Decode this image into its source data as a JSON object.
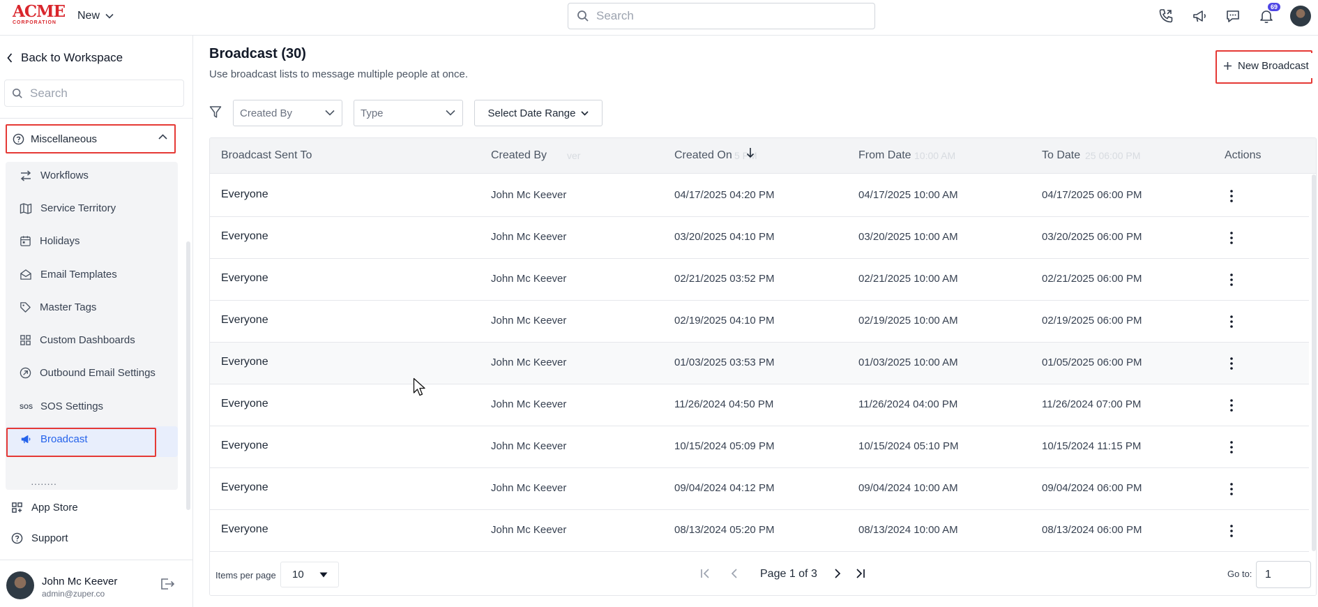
{
  "header": {
    "logo_main": "ACME",
    "logo_sub": "CORPORATION",
    "new_label": "New",
    "search_placeholder": "Search",
    "notification_count": "69"
  },
  "sidebar": {
    "back_label": "Back to Workspace",
    "search_placeholder": "Search",
    "section_label": "Miscellaneous",
    "items": [
      {
        "label": "Workflows",
        "icon": "arrows-swap-icon"
      },
      {
        "label": "Service Territory",
        "icon": "map-icon"
      },
      {
        "label": "Holidays",
        "icon": "calendar-icon"
      },
      {
        "label": "Email Templates",
        "icon": "envelope-open-icon"
      },
      {
        "label": "Master Tags",
        "icon": "tag-icon"
      },
      {
        "label": "Custom Dashboards",
        "icon": "dashboard-grid-icon"
      },
      {
        "label": "Outbound Email Settings",
        "icon": "outbound-arrow-icon"
      },
      {
        "label": "SOS Settings",
        "icon": "sos-icon"
      },
      {
        "label": "Broadcast",
        "icon": "megaphone-icon"
      }
    ],
    "bottom_items": [
      {
        "label": "App Store",
        "icon": "app-grid-icon"
      },
      {
        "label": "Support",
        "icon": "help-circle-icon"
      }
    ],
    "user": {
      "name": "John Mc Keever",
      "email": "admin@zuper.co"
    }
  },
  "main": {
    "title": "Broadcast (30)",
    "subtitle": "Use broadcast lists to message multiple people at once.",
    "new_button_label": "New Broadcast",
    "filters": {
      "created_by_placeholder": "Created By",
      "type_placeholder": "Type",
      "date_range_label": "Select Date Range"
    },
    "table": {
      "columns": [
        "Broadcast Sent To",
        "Created By",
        "Created On",
        "From Date",
        "To Date",
        "Actions"
      ],
      "ghost_header": {
        "created_by": "ver",
        "created_on": "5 PM",
        "from_date": "10:00 AM",
        "to_date": "25 06:00 PM"
      },
      "rows": [
        [
          "Everyone",
          "John Mc Keever",
          "04/17/2025 04:20 PM",
          "04/17/2025 10:00 AM",
          "04/17/2025 06:00 PM"
        ],
        [
          "Everyone",
          "John Mc Keever",
          "03/20/2025 04:10 PM",
          "03/20/2025 10:00 AM",
          "03/20/2025 06:00 PM"
        ],
        [
          "Everyone",
          "John Mc Keever",
          "02/21/2025 03:52 PM",
          "02/21/2025 10:00 AM",
          "02/21/2025 06:00 PM"
        ],
        [
          "Everyone",
          "John Mc Keever",
          "02/19/2025 04:10 PM",
          "02/19/2025 10:00 AM",
          "02/19/2025 06:00 PM"
        ],
        [
          "Everyone",
          "John Mc Keever",
          "01/03/2025 03:53 PM",
          "01/03/2025 10:00 AM",
          "01/05/2025 06:00 PM"
        ],
        [
          "Everyone",
          "John Mc Keever",
          "11/26/2024 04:50 PM",
          "11/26/2024 04:00 PM",
          "11/26/2024 07:00 PM"
        ],
        [
          "Everyone",
          "John Mc Keever",
          "10/15/2024 05:09 PM",
          "10/15/2024 05:10 PM",
          "10/15/2024 11:15 PM"
        ],
        [
          "Everyone",
          "John Mc Keever",
          "09/04/2024 04:12 PM",
          "09/04/2024 10:00 AM",
          "09/04/2024 06:00 PM"
        ],
        [
          "Everyone",
          "John Mc Keever",
          "08/13/2024 05:20 PM",
          "08/13/2024 10:00 AM",
          "08/13/2024 06:00 PM"
        ]
      ]
    },
    "pagination": {
      "items_per_page_label": "Items per page",
      "items_per_page_value": "10",
      "page_info": "Page 1 of 3",
      "goto_label": "Go to:",
      "goto_value": "1"
    }
  },
  "colors": {
    "highlight_red": "#e53935",
    "active_bg": "#e8eefc",
    "brand_red": "#d9262c",
    "accent_blue": "#2563eb"
  }
}
